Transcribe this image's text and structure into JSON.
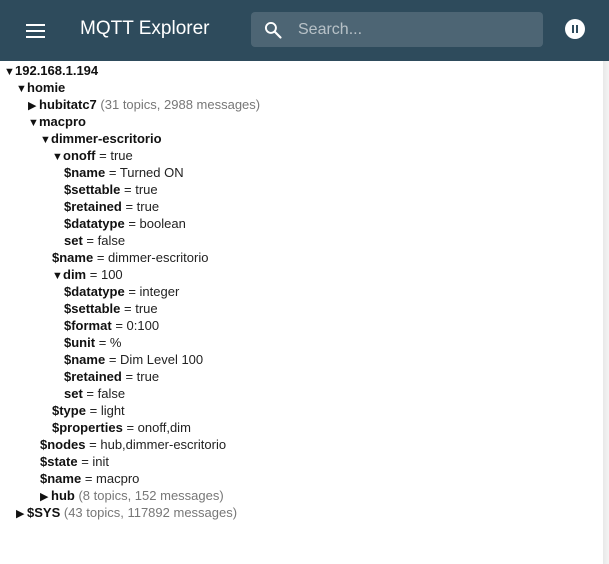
{
  "app": {
    "title": "MQTT Explorer",
    "search_placeholder": "Search...",
    "menu_icon": "hamburger-menu-icon",
    "pause_icon": "pause-icon"
  },
  "tree": {
    "root": "192.168.1.194",
    "homie": "homie",
    "hubitatc7": "hubitatc7",
    "hubitatc7_meta": "(31 topics, 2988 messages)",
    "macpro": "macpro",
    "dimmer": "dimmer-escritorio",
    "onoff": "onoff",
    "onoff_value": "true",
    "onoff_name_key": "$name",
    "onoff_name_value": "Turned ON",
    "onoff_settable_key": "$settable",
    "onoff_settable_value": "true",
    "onoff_retained_key": "$retained",
    "onoff_retained_value": "true",
    "onoff_datatype_key": "$datatype",
    "onoff_datatype_value": "boolean",
    "onoff_set_key": "set",
    "onoff_set_value": "false",
    "dimmer_name_key": "$name",
    "dimmer_name_value": "dimmer-escritorio",
    "dim": "dim",
    "dim_value": "100",
    "dim_datatype_key": "$datatype",
    "dim_datatype_value": "integer",
    "dim_settable_key": "$settable",
    "dim_settable_value": "true",
    "dim_format_key": "$format",
    "dim_format_value": "0:100",
    "dim_unit_key": "$unit",
    "dim_unit_value": "%",
    "dim_name_key": "$name",
    "dim_name_value": "Dim Level 100",
    "dim_retained_key": "$retained",
    "dim_retained_value": "true",
    "dim_set_key": "set",
    "dim_set_value": "false",
    "dimmer_type_key": "$type",
    "dimmer_type_value": "light",
    "dimmer_properties_key": "$properties",
    "dimmer_properties_value": "onoff,dim",
    "macpro_nodes_key": "$nodes",
    "macpro_nodes_value": "hub,dimmer-escritorio",
    "macpro_state_key": "$state",
    "macpro_state_value": "init",
    "macpro_name_key": "$name",
    "macpro_name_value": "macpro",
    "hub": "hub",
    "hub_meta": "(8 topics, 152 messages)",
    "sys": "$SYS",
    "sys_meta": "(43 topics, 117892 messages)",
    "expanded_glyph": "▼",
    "collapsed_glyph": "▶",
    "equals": "="
  }
}
